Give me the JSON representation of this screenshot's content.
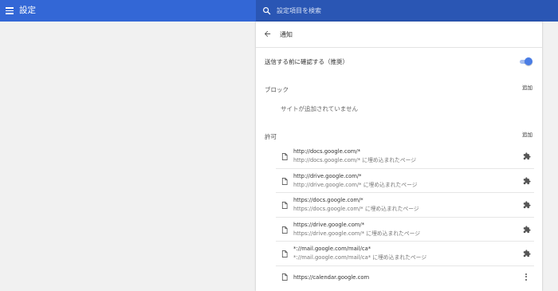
{
  "header": {
    "menu_icon": "hamburger-menu-icon",
    "title": "設定",
    "search_icon": "search-icon",
    "search_placeholder": "設定項目を検索",
    "bar_color": "#3367d6"
  },
  "page": {
    "back_icon": "back-arrow-icon",
    "title": "通知"
  },
  "ask_before_sending": {
    "label": "送信する前に確認する（推奨）",
    "enabled": true,
    "accent_color": "#4a7de5"
  },
  "block_section": {
    "label": "ブロック",
    "add_label": "追加",
    "empty_text": "サイトが追加されていません"
  },
  "allow_section": {
    "label": "許可",
    "add_label": "追加",
    "sites": [
      {
        "url": "http://docs.google.com/*",
        "sub": "http://docs.google.com/* に埋め込まれたページ",
        "action_icon": "puzzle-extension-icon"
      },
      {
        "url": "http://drive.google.com/*",
        "sub": "http://drive.google.com/* に埋め込まれたページ",
        "action_icon": "puzzle-extension-icon"
      },
      {
        "url": "https://docs.google.com/*",
        "sub": "https://docs.google.com/* に埋め込まれたページ",
        "action_icon": "puzzle-extension-icon"
      },
      {
        "url": "https://drive.google.com/*",
        "sub": "https://drive.google.com/* に埋め込まれたページ",
        "action_icon": "puzzle-extension-icon"
      },
      {
        "url": "*://mail.google.com/mail/ca*",
        "sub": "*://mail.google.com/mail/ca* に埋め込まれたページ",
        "action_icon": "puzzle-extension-icon"
      },
      {
        "url": "https://calendar.google.com",
        "action_icon": "more-vert-icon"
      }
    ]
  }
}
